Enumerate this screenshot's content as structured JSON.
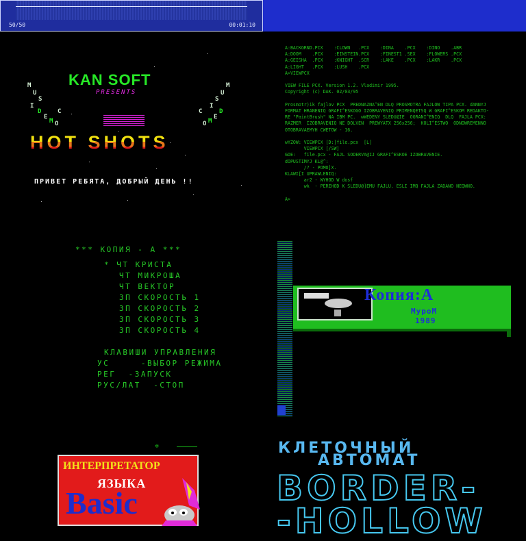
{
  "player": {
    "position": "50/50",
    "time": "00:01:10"
  },
  "demo": {
    "brand": "KAN SOFT",
    "presents": "PRESENTS",
    "title": "HOT SHOTS",
    "greeting": "ПРИВЕТ РЕБЯТА, ДОБРЫЙ ДЕНЬ !!",
    "left_letters": [
      "M",
      "U",
      "S",
      "I",
      "C",
      "D",
      "E",
      "M",
      "O"
    ],
    "right_letters": [
      "M",
      "U",
      "S",
      "I",
      "C",
      "D",
      "E",
      "M",
      "O"
    ]
  },
  "listing": {
    "text": "A:BACKGRND.PCX    :CLOWN   .PCX    :DINA    .PCX    :DINO    .ABR\nA:DOOM    .PCX    :EINSTEIN.PCX    :FINEST1 .SEX    :FLOWERS .PCX\nA:GEISHA  .PCX    :KNIGHT  .SCR    :LAKE    .PCX    :LAKR    .PCX\nA:LIGHT   .PCX    :LUSH    .PCX\nA>VIEWPCX\n\nVIEW FILE PCX. Version 1.2. Vladimir 1995.\nCopyright (c) DAK. 02/03/95\n\nProsmotr)ik fajlov PCX  PREDNAZNA^EN DLQ PROSMOTRA FAJLOW TIPA PCX. dANNYJ\nFORMAT HRANENIQ GRAFI^ESKOGO IZOBRAVENIQ PRIMENQETSQ W GRAFI^ESKOM REDAKTO-\nRE \"PaintBrush\" NA IBM PC.  wWEDENY SLEDU@IE  OGRANI^ENIQ  DLQ  FAJLA PCX:\nRAZMER  IZOBRAVENIQ NE DOLVEN  PREWYATX 256x256;  KOLI^ESTWO  ODNOWREMENNO\nOTOBRAVAEMYH CWETOW - 16.\n\nwYZOW: VIEWPCX [D:]file.pcx  [L]\n       VIEWPCX [/SW]\nGDE:   file.pcx - FAJL SODERVA@IJ GRAFI^ESKOE IZOBRAVENIE.\ndOPUSTIMYJ KL@^:\n       /? - POMO]X.\nKLAWI[I UPRAWLENIQ:\n       ar2 - WYHOD W dosf\n       wk  - PEREHOD K SLEDU@]EMU FAJLU. ESLI IMQ FAJLA ZADANO NEQWNO.\n\nA>"
  },
  "menu": {
    "header": "*** КОПИЯ - А ***",
    "items": [
      "* ЧТ КРИСТА",
      "ЧТ МИКРОША",
      "ЧТ ВЕКТОР",
      "ЗП СКОРОСТЬ 1",
      "ЗП СКОРОСТЬ 2",
      "ЗП СКОРОСТЬ 3",
      "ЗП СКОРОСТЬ 4"
    ],
    "keys_title": "КЛАВИШИ УПРАВЛЕНИЯ",
    "keys": [
      "УС     -ВЫБОР РЕЖИМА",
      "РЕГ  -ЗАПУСК",
      "РУС/ЛАТ  -СТОП"
    ]
  },
  "kopiya": {
    "title": "Копия:А",
    "city": "МуроМ",
    "year": "1989"
  },
  "basic": {
    "line1": "ИНТЕРПРЕТАТОР",
    "line2": "ЯЗЫКА",
    "line3": "Basic"
  },
  "cell": {
    "line1": "КЛЕТОЧНЫЙ",
    "line2": "АВТОМАТ",
    "big1": "BORDER-",
    "big2": "-HOLLOW"
  },
  "colors": {
    "green": "#27e827",
    "blue": "#1e2dcc",
    "magenta": "#e42be4",
    "cyan": "#46c8f0"
  }
}
